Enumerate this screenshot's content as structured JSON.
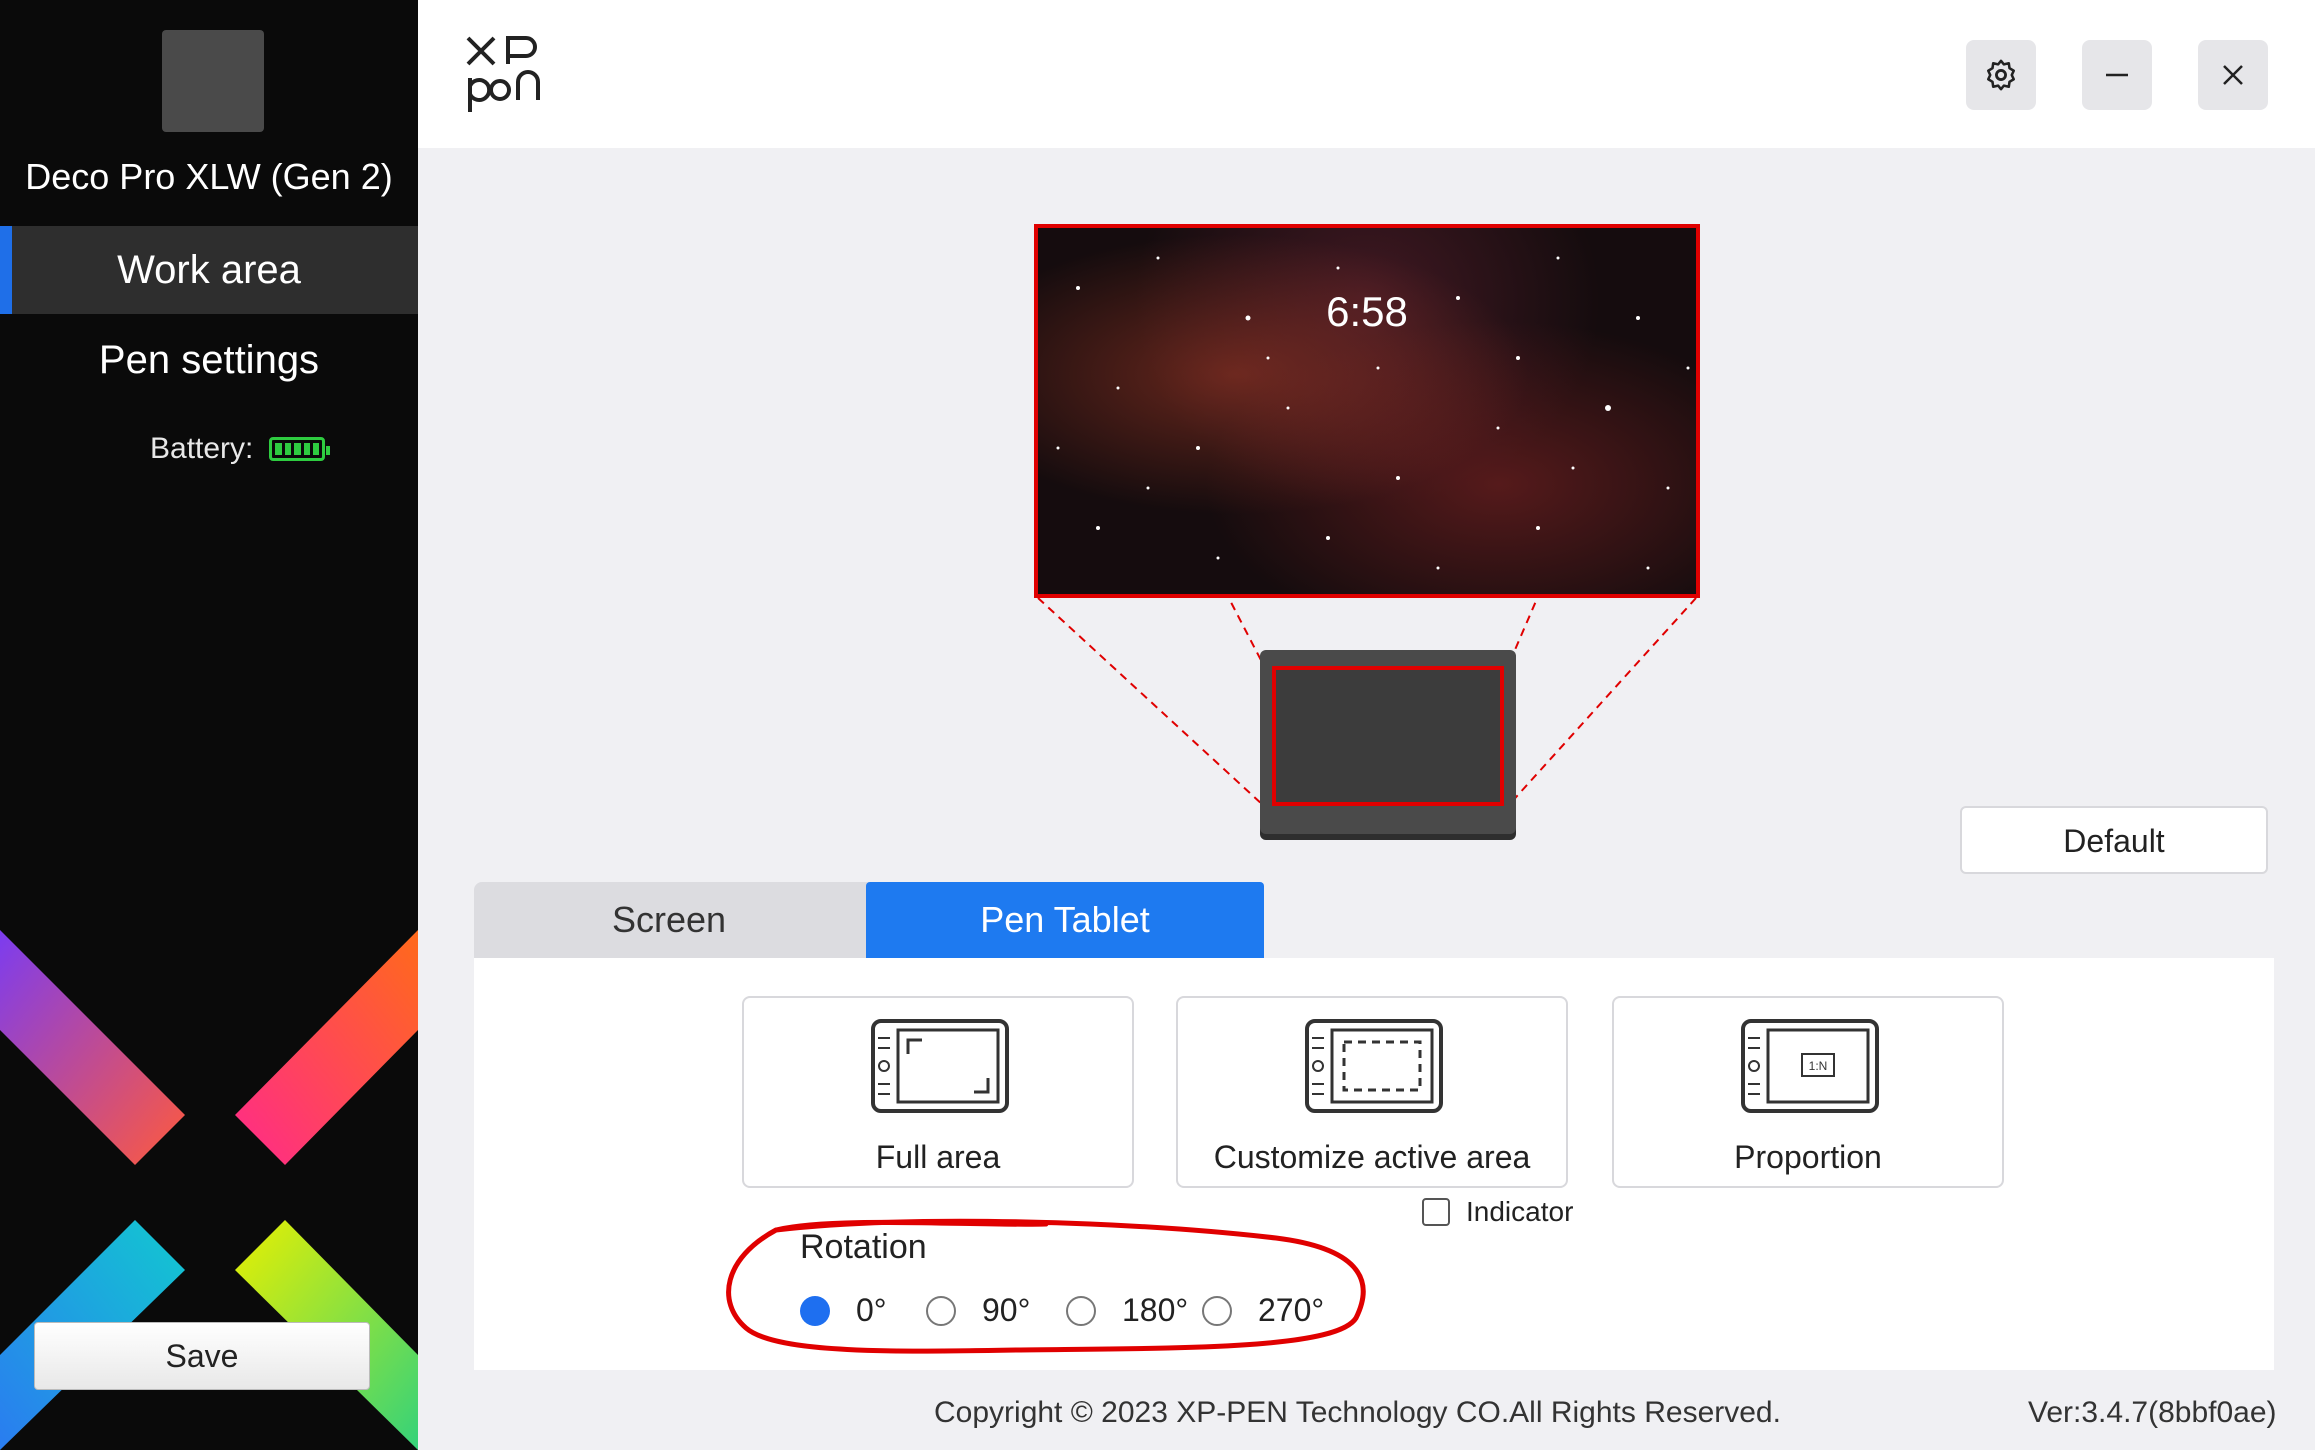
{
  "sidebar": {
    "device_name": "Deco Pro XLW (Gen 2)",
    "nav": [
      {
        "label": "Work area",
        "active": true
      },
      {
        "label": "Pen settings",
        "active": false
      }
    ],
    "battery_label": "Battery:",
    "battery_level": 1.0,
    "save_label": "Save"
  },
  "header": {
    "logo_line1": "XP",
    "logo_line2": "pen",
    "icons": [
      "gear-icon",
      "minimize-icon",
      "close-icon"
    ]
  },
  "preview": {
    "clock": "6:58"
  },
  "default_label": "Default",
  "tabs": [
    {
      "label": "Screen",
      "active": false
    },
    {
      "label": "Pen Tablet",
      "active": true
    }
  ],
  "modes": [
    {
      "label": "Full area",
      "icon": "full-area-icon"
    },
    {
      "label": "Customize active area",
      "icon": "custom-area-icon"
    },
    {
      "label": "Proportion",
      "icon": "proportion-icon",
      "badge": "1:N"
    }
  ],
  "rotation": {
    "title": "Rotation",
    "options": [
      "0°",
      "90°",
      "180°",
      "270°"
    ],
    "selected": "0°"
  },
  "indicator": {
    "label": "Indicator",
    "checked": false
  },
  "footer": {
    "copyright": "Copyright © 2023  XP-PEN Technology CO.All Rights Reserved.",
    "version": "Ver:3.4.7(8bbf0ae)"
  },
  "colors": {
    "accent": "#1e7af0",
    "highlight_red": "#e00000",
    "sidebar_bg": "#0a0a0a"
  }
}
